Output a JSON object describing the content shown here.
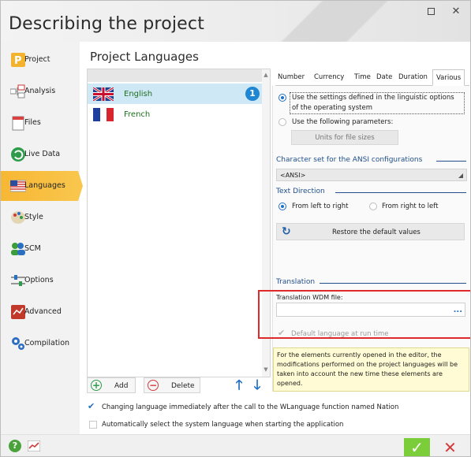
{
  "window": {
    "title": "Describing the project"
  },
  "sidebar": {
    "items": [
      {
        "label": "Project",
        "icon": "project-icon"
      },
      {
        "label": "Analysis",
        "icon": "analysis-icon"
      },
      {
        "label": "Files",
        "icon": "files-icon"
      },
      {
        "label": "Live Data",
        "icon": "live-data-icon"
      },
      {
        "label": "Languages",
        "icon": "languages-icon",
        "active": true
      },
      {
        "label": "Style",
        "icon": "style-icon"
      },
      {
        "label": "SCM",
        "icon": "scm-icon"
      },
      {
        "label": "Options",
        "icon": "options-icon"
      },
      {
        "label": "Advanced",
        "icon": "advanced-icon"
      },
      {
        "label": "Compilation",
        "icon": "compilation-icon"
      }
    ]
  },
  "main": {
    "title": "Project Languages",
    "languages": [
      {
        "name": "English",
        "flag": "uk-flag-icon",
        "badge": "1",
        "selected": true
      },
      {
        "name": "French",
        "flag": "france-flag-icon"
      }
    ],
    "add_label": "Add",
    "delete_label": "Delete",
    "change_language_label": "Changing language immediately after the call to the WLanguage function named Nation",
    "auto_select_label": "Automatically select the system language when starting the application"
  },
  "tabs": [
    "Number",
    "Currency",
    "Time",
    "Date",
    "Duration",
    "Various"
  ],
  "active_tab": "Various",
  "various": {
    "opt_linguistic_line1": "Use the settings defined in the linguistic options",
    "opt_linguistic_line2": "of the operating system",
    "opt_following": "Use the following parameters:",
    "units_button": "Units for file sizes",
    "charset_section": "Character set for the ANSI configurations",
    "charset_value": "<ANSI>",
    "text_direction_section": "Text Direction",
    "ltr_label": "From left to right",
    "rtl_label": "From right to left",
    "restore_label": "Restore the default values",
    "translation_section": "Translation",
    "wdm_label": "Translation WDM file:",
    "wdm_value": "",
    "wdm_browse": "...",
    "default_language_label": "Default language at run time",
    "note": "For the elements currently opened in the editor, the modifications performed on the project languages will be taken into account the new time these elements are opened."
  },
  "colors": {
    "active_nav": "#f7b733",
    "accent": "#1f6fc5",
    "section": "#1f4e8a",
    "highlight_box": "#e02a2a",
    "ok": "#7ccd3a",
    "cancel": "#d23b3b"
  }
}
